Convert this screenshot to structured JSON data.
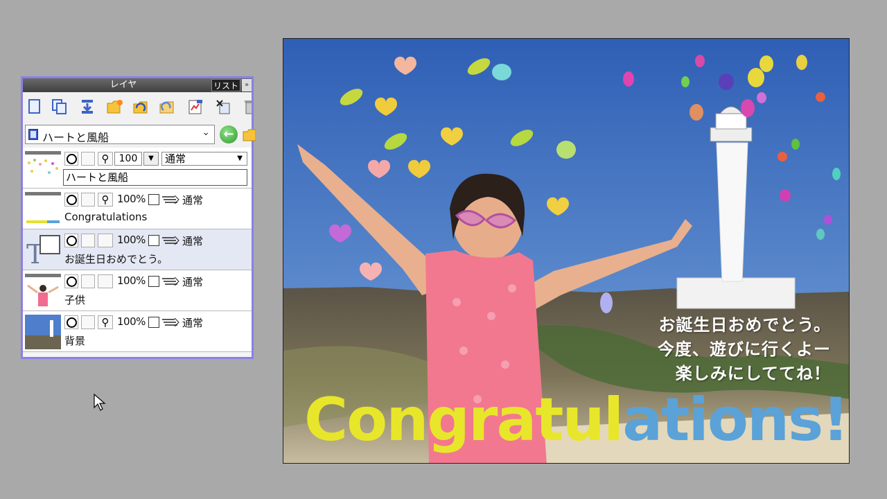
{
  "panel": {
    "title": "レイヤ",
    "list_button": "リスト",
    "pin": "»",
    "toolbar_icons": [
      "new-layer-icon",
      "duplicate-layer-icon",
      "merge-down-icon",
      "new-folder-icon",
      "folder-open-icon",
      "folder-up-icon",
      "layer-property-icon",
      "delete-layer-icon",
      "trash-icon"
    ],
    "selected_layer": "ハートと風船",
    "go_icon": "green-arrow-left-icon"
  },
  "layers": [
    {
      "visible": true,
      "opacity": "100",
      "blend": "通常",
      "name": "ハートと風船"
    },
    {
      "visible": true,
      "opacity": "100%",
      "blend": "通常",
      "name": "Congratulations"
    },
    {
      "visible": true,
      "opacity": "100%",
      "blend": "通常",
      "name": "お誕生日おめでとう。"
    },
    {
      "visible": true,
      "opacity": "100%",
      "blend": "通常",
      "name": "子供"
    },
    {
      "visible": true,
      "opacity": "100%",
      "blend": "通常",
      "name": "背景"
    }
  ],
  "canvas": {
    "message_lines": [
      "お誕生日おめでとう。",
      "今度、遊びに行くよー",
      "楽しみにしててね！"
    ],
    "banner": [
      {
        "text": "Congratul",
        "color": "#e8e62a"
      },
      {
        "text": "ations!",
        "color": "#5aa2d8"
      }
    ],
    "sky_top": "#2f5fb5",
    "sky_bottom": "#7aa6dc"
  }
}
